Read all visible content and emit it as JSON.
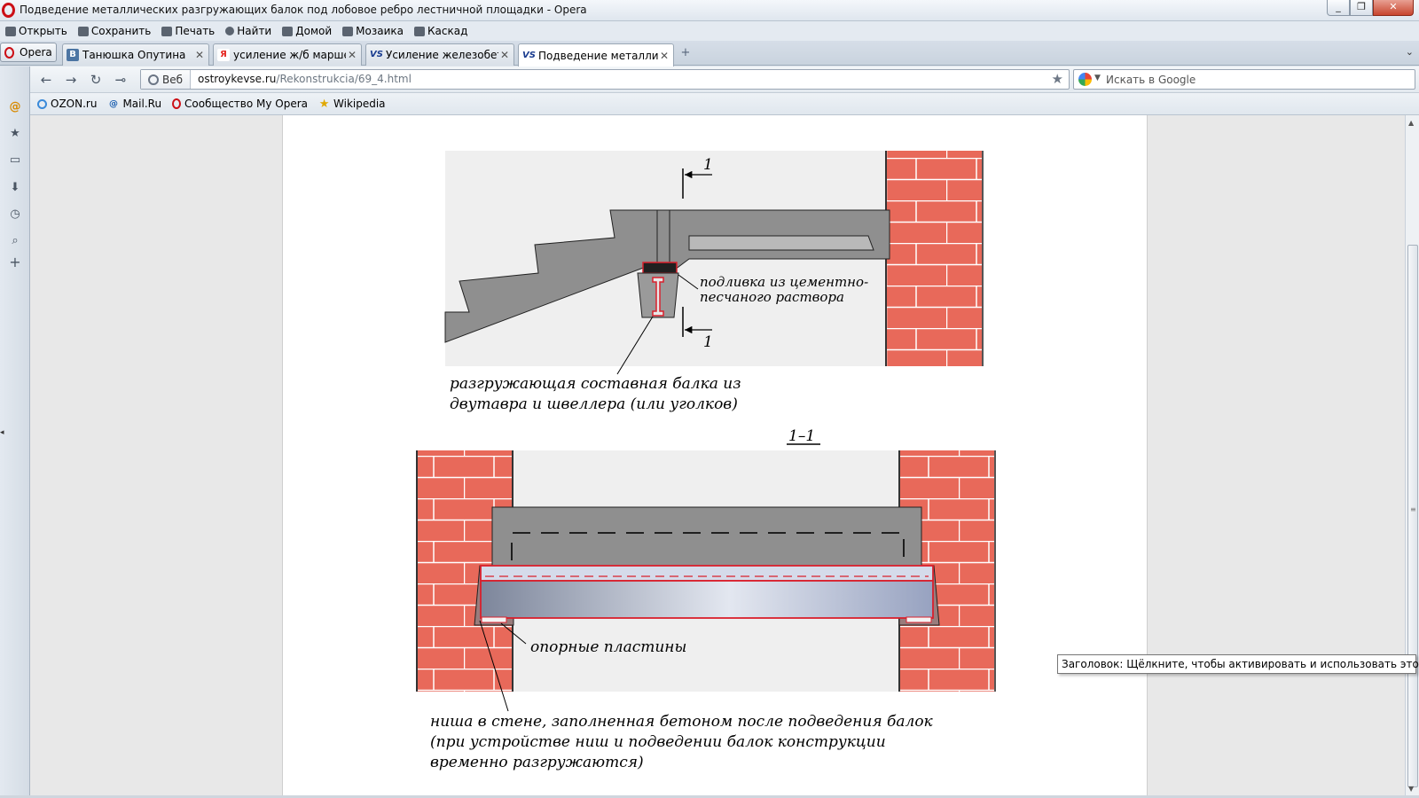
{
  "window": {
    "title": "Подведение металлических разгружающих балок под лобовое ребро лестничной площадки - Opera",
    "controls": [
      "_",
      "❐",
      "✕"
    ]
  },
  "menubar": {
    "items": [
      "Открыть",
      "Сохранить",
      "Печать",
      "Найти",
      "Домой",
      "Мозаика",
      "Каскад"
    ]
  },
  "tabs": {
    "opera_menu": "Opera",
    "items": [
      {
        "label": "Танюшка Опутина",
        "favicon": "В",
        "color": "#4c75a3"
      },
      {
        "label": "усиление ж/б марше...",
        "favicon": "Я",
        "color": "#e52620"
      },
      {
        "label": "Усиление железобето...",
        "favicon": "VS",
        "color": "#1a3c8f"
      },
      {
        "label": "Подведение металлич...",
        "favicon": "VS",
        "color": "#1a3c8f"
      }
    ],
    "close_glyph": "✕",
    "new_tab_glyph": "+",
    "list_glyph": "⌄"
  },
  "address": {
    "web_label": "Веб",
    "url_domain": "ostroykevse.ru",
    "url_path": "/Rekonstrukcia/69_4.html",
    "search_placeholder": "Искать в Google"
  },
  "bookmarks": {
    "items": [
      "OZON.ru",
      "Mail.Ru",
      "Сообщество My Opera",
      "Wikipedia"
    ]
  },
  "figure": {
    "section_mark": "1",
    "section_title": "1–1",
    "label_grout_1": "подливка из цементно-",
    "label_grout_2": "песчаного раствора",
    "label_beam_1": "разгружающая составная балка из",
    "label_beam_2": "двутавра и швеллера (или уголков)",
    "label_plates": "опорные пластины",
    "label_niche_1": "ниша в стене, заполненная бетоном после подведения балок",
    "label_niche_2": "(при устройстве ниш и подведении балок конструкции",
    "label_niche_3": "временно разгружаются)"
  },
  "colors": {
    "brick": "#e8695a",
    "concrete": "#8f8f8f",
    "steel_red": "#d9202c",
    "opera_red": "#cc0f16"
  },
  "tooltip": {
    "text": "Заголовок: Щёлкните, чтобы активировать и использовать этот элемент"
  }
}
